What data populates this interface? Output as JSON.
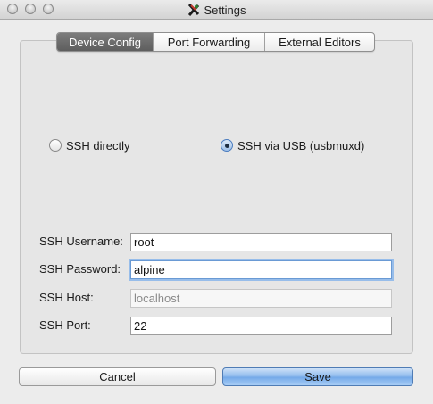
{
  "window": {
    "title": "Settings"
  },
  "tabs": [
    {
      "label": "Device Config",
      "active": true
    },
    {
      "label": "Port Forwarding",
      "active": false
    },
    {
      "label": "External Editors",
      "active": false
    }
  ],
  "connection": {
    "options": [
      {
        "label": "SSH directly",
        "selected": false
      },
      {
        "label": "SSH via USB (usbmuxd)",
        "selected": true
      }
    ]
  },
  "fields": {
    "username": {
      "label": "SSH Username:",
      "value": "root"
    },
    "password": {
      "label": "SSH Password:",
      "value": "alpine",
      "focused": true
    },
    "host": {
      "label": "SSH Host:",
      "value": "localhost",
      "enabled": false
    },
    "port": {
      "label": "SSH Port:",
      "value": "22"
    }
  },
  "buttons": {
    "cancel": "Cancel",
    "save": "Save"
  },
  "colors": {
    "active_tab": "#6b6b6b",
    "save_button": "#8ab8ec",
    "focus_ring": "#97bdea"
  }
}
